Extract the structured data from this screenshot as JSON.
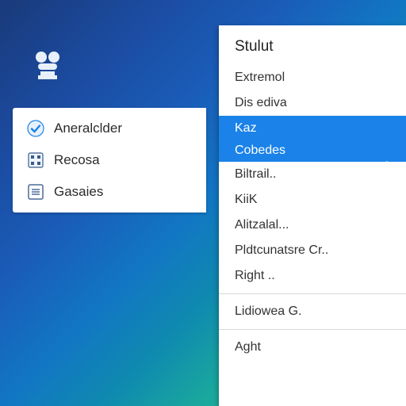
{
  "left_panel": {
    "items": [
      {
        "label": "Aneralclder"
      },
      {
        "label": "Recosa"
      },
      {
        "label": "Gasaies"
      }
    ]
  },
  "context_menu": {
    "heading": "Stulut",
    "groups": [
      [
        {
          "label": "Extremol",
          "selected": false
        },
        {
          "label": "Dis ediva",
          "selected": false
        },
        {
          "label": "Kaz",
          "selected": true
        },
        {
          "label": "Cobedes",
          "selected": true
        },
        {
          "label": "Biltrail..",
          "selected": false
        },
        {
          "label": "KiiK",
          "selected": false
        },
        {
          "label": "Alitzalal...",
          "selected": false
        },
        {
          "label": "Pldtcunatsre Cr..",
          "selected": false
        },
        {
          "label": "Right ..",
          "selected": false
        }
      ],
      [
        {
          "label": "Lidiowea G.",
          "selected": false
        }
      ],
      [
        {
          "label": "Aght",
          "selected": false
        }
      ]
    ]
  },
  "colors": {
    "accent": "#1a82e8"
  }
}
